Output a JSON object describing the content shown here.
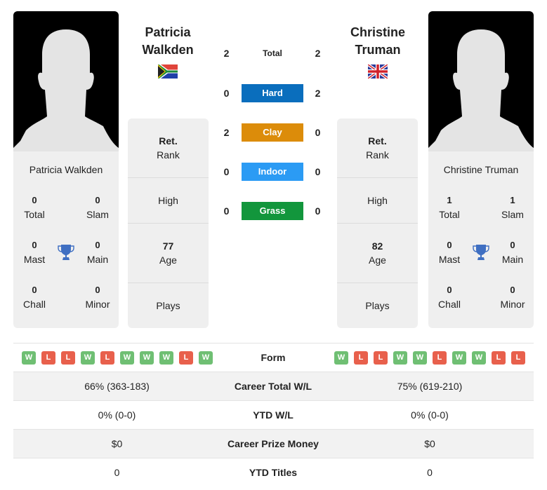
{
  "player1": {
    "name_line1": "Patricia",
    "name_line2": "Walkden",
    "full_name": "Patricia Walkden",
    "flag_icon": "south-africa-flag",
    "titles": {
      "total": "0",
      "total_label": "Total",
      "slam": "0",
      "slam_label": "Slam",
      "mast": "0",
      "mast_label": "Mast",
      "main": "0",
      "main_label": "Main",
      "chall": "0",
      "chall_label": "Chall",
      "minor": "0",
      "minor_label": "Minor"
    },
    "info": {
      "rank_value": "Ret.",
      "rank_label": "Rank",
      "high_label": "High",
      "age_value": "77",
      "age_label": "Age",
      "plays_label": "Plays"
    },
    "form": [
      "W",
      "L",
      "L",
      "W",
      "L",
      "W",
      "W",
      "W",
      "L",
      "W"
    ]
  },
  "player2": {
    "name_line1": "Christine",
    "name_line2": "Truman",
    "full_name": "Christine Truman",
    "flag_icon": "united-kingdom-flag",
    "titles": {
      "total": "1",
      "total_label": "Total",
      "slam": "1",
      "slam_label": "Slam",
      "mast": "0",
      "mast_label": "Mast",
      "main": "0",
      "main_label": "Main",
      "chall": "0",
      "chall_label": "Chall",
      "minor": "0",
      "minor_label": "Minor"
    },
    "info": {
      "rank_value": "Ret.",
      "rank_label": "Rank",
      "high_label": "High",
      "age_value": "82",
      "age_label": "Age",
      "plays_label": "Plays"
    },
    "form": [
      "W",
      "L",
      "L",
      "W",
      "W",
      "L",
      "W",
      "W",
      "L",
      "L"
    ]
  },
  "h2h": [
    {
      "label": "Total",
      "p1": "2",
      "p2": "2",
      "color": ""
    },
    {
      "label": "Hard",
      "p1": "0",
      "p2": "2",
      "color": "#0a6ebd"
    },
    {
      "label": "Clay",
      "p1": "2",
      "p2": "0",
      "color": "#dc8c0a"
    },
    {
      "label": "Indoor",
      "p1": "0",
      "p2": "0",
      "color": "#2b9bf4"
    },
    {
      "label": "Grass",
      "p1": "0",
      "p2": "0",
      "color": "#12963c"
    }
  ],
  "table": {
    "form_label": "Form",
    "rows": [
      {
        "label": "Career Total W/L",
        "p1": "66% (363-183)",
        "p2": "75% (619-210)"
      },
      {
        "label": "YTD W/L",
        "p1": "0% (0-0)",
        "p2": "0% (0-0)"
      },
      {
        "label": "Career Prize Money",
        "p1": "$0",
        "p2": "$0"
      },
      {
        "label": "YTD Titles",
        "p1": "0",
        "p2": "0"
      }
    ]
  }
}
